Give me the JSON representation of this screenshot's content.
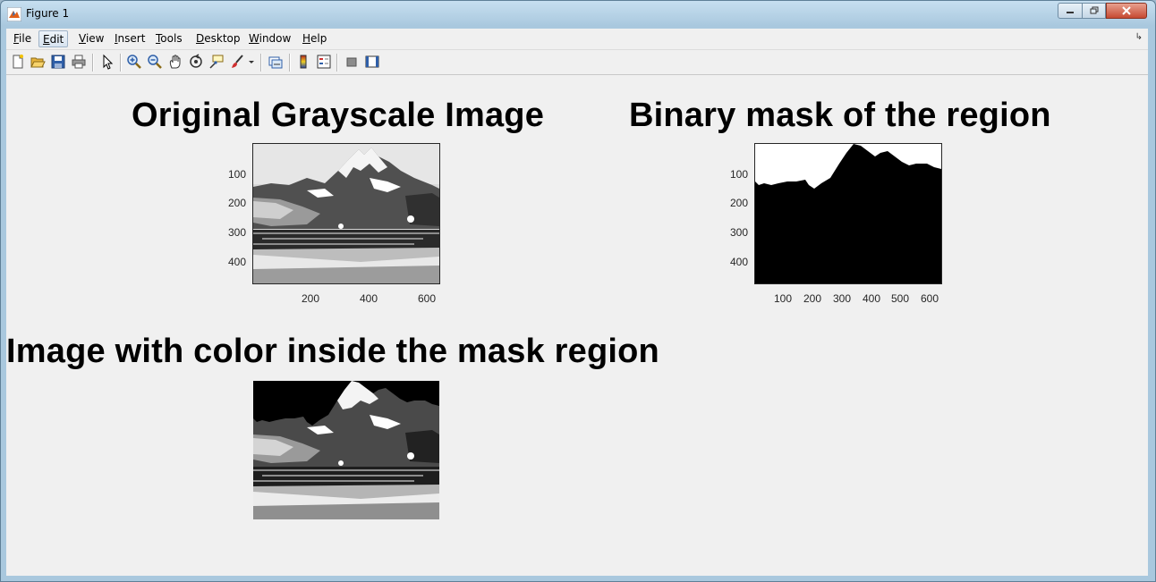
{
  "window": {
    "title": "Figure 1"
  },
  "menubar": {
    "items": [
      {
        "label": "File",
        "mnemonic": "F",
        "rest": "ile"
      },
      {
        "label": "Edit",
        "mnemonic": "E",
        "rest": "dit"
      },
      {
        "label": "View",
        "mnemonic": "V",
        "rest": "iew"
      },
      {
        "label": "Insert",
        "mnemonic": "I",
        "rest": "nsert"
      },
      {
        "label": "Tools",
        "mnemonic": "T",
        "rest": "ools"
      },
      {
        "label": "Desktop",
        "mnemonic": "D",
        "rest": "esktop"
      },
      {
        "label": "Window",
        "mnemonic": "W",
        "rest": "indow"
      },
      {
        "label": "Help",
        "mnemonic": "H",
        "rest": "elp"
      }
    ],
    "active": "Edit"
  },
  "toolbar": {
    "icons": [
      "new-figure-icon",
      "open-file-icon",
      "save-icon",
      "print-icon",
      "edit-plot-icon",
      "zoom-in-icon",
      "zoom-out-icon",
      "pan-icon",
      "rotate-3d-icon",
      "data-cursor-icon",
      "brush-icon",
      "brush-dropdown-icon",
      "link-plot-icon",
      "colorbar-icon",
      "legend-icon",
      "hide-plot-tools-icon",
      "show-plot-tools-icon"
    ]
  },
  "plots": {
    "original": {
      "title": "Original Grayscale Image",
      "yticks": [
        "100",
        "200",
        "300",
        "400"
      ],
      "xticks": [
        "200",
        "400",
        "600"
      ]
    },
    "mask": {
      "title": "Binary mask of the region",
      "yticks": [
        "100",
        "200",
        "300",
        "400"
      ],
      "xticks": [
        "100",
        "200",
        "300",
        "400",
        "500",
        "600"
      ]
    },
    "colored": {
      "title": "Image with color inside the mask region"
    }
  },
  "colors": {
    "window_frame": "#a9c8de",
    "figure_bg": "#f0f0f0",
    "close_button": "#c64a32"
  }
}
